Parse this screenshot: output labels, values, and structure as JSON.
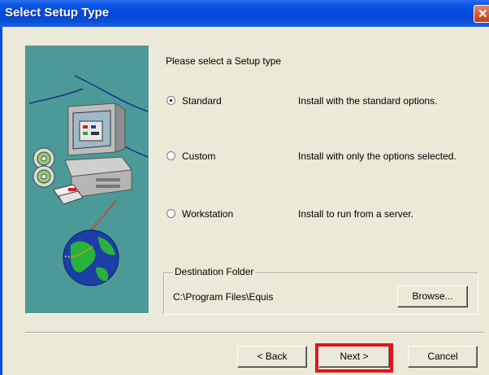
{
  "window": {
    "title": "Select Setup Type",
    "close_glyph": "✕"
  },
  "prompt": "Please select a Setup type",
  "options": [
    {
      "label": "Standard",
      "description": "Install with the standard options.",
      "selected": true
    },
    {
      "label": "Custom",
      "description": "Install with only the options selected.",
      "selected": false
    },
    {
      "label": "Workstation",
      "description": "Install to run from a server.",
      "selected": false
    }
  ],
  "destination": {
    "group_label": "Destination Folder",
    "path": "C:\\Program Files\\Equis",
    "browse_label": "Browse..."
  },
  "footer": {
    "back_label": "< Back",
    "next_label": "Next >",
    "cancel_label": "Cancel"
  },
  "colors": {
    "titlebar": "#0447d6",
    "panel_bg": "#ece9d8",
    "graphic_bg": "#4b9a97",
    "highlight": "#e3141a"
  },
  "icons": [
    "computer-monitor-icon",
    "cd-disc-icon",
    "globe-icon",
    "close-icon"
  ]
}
